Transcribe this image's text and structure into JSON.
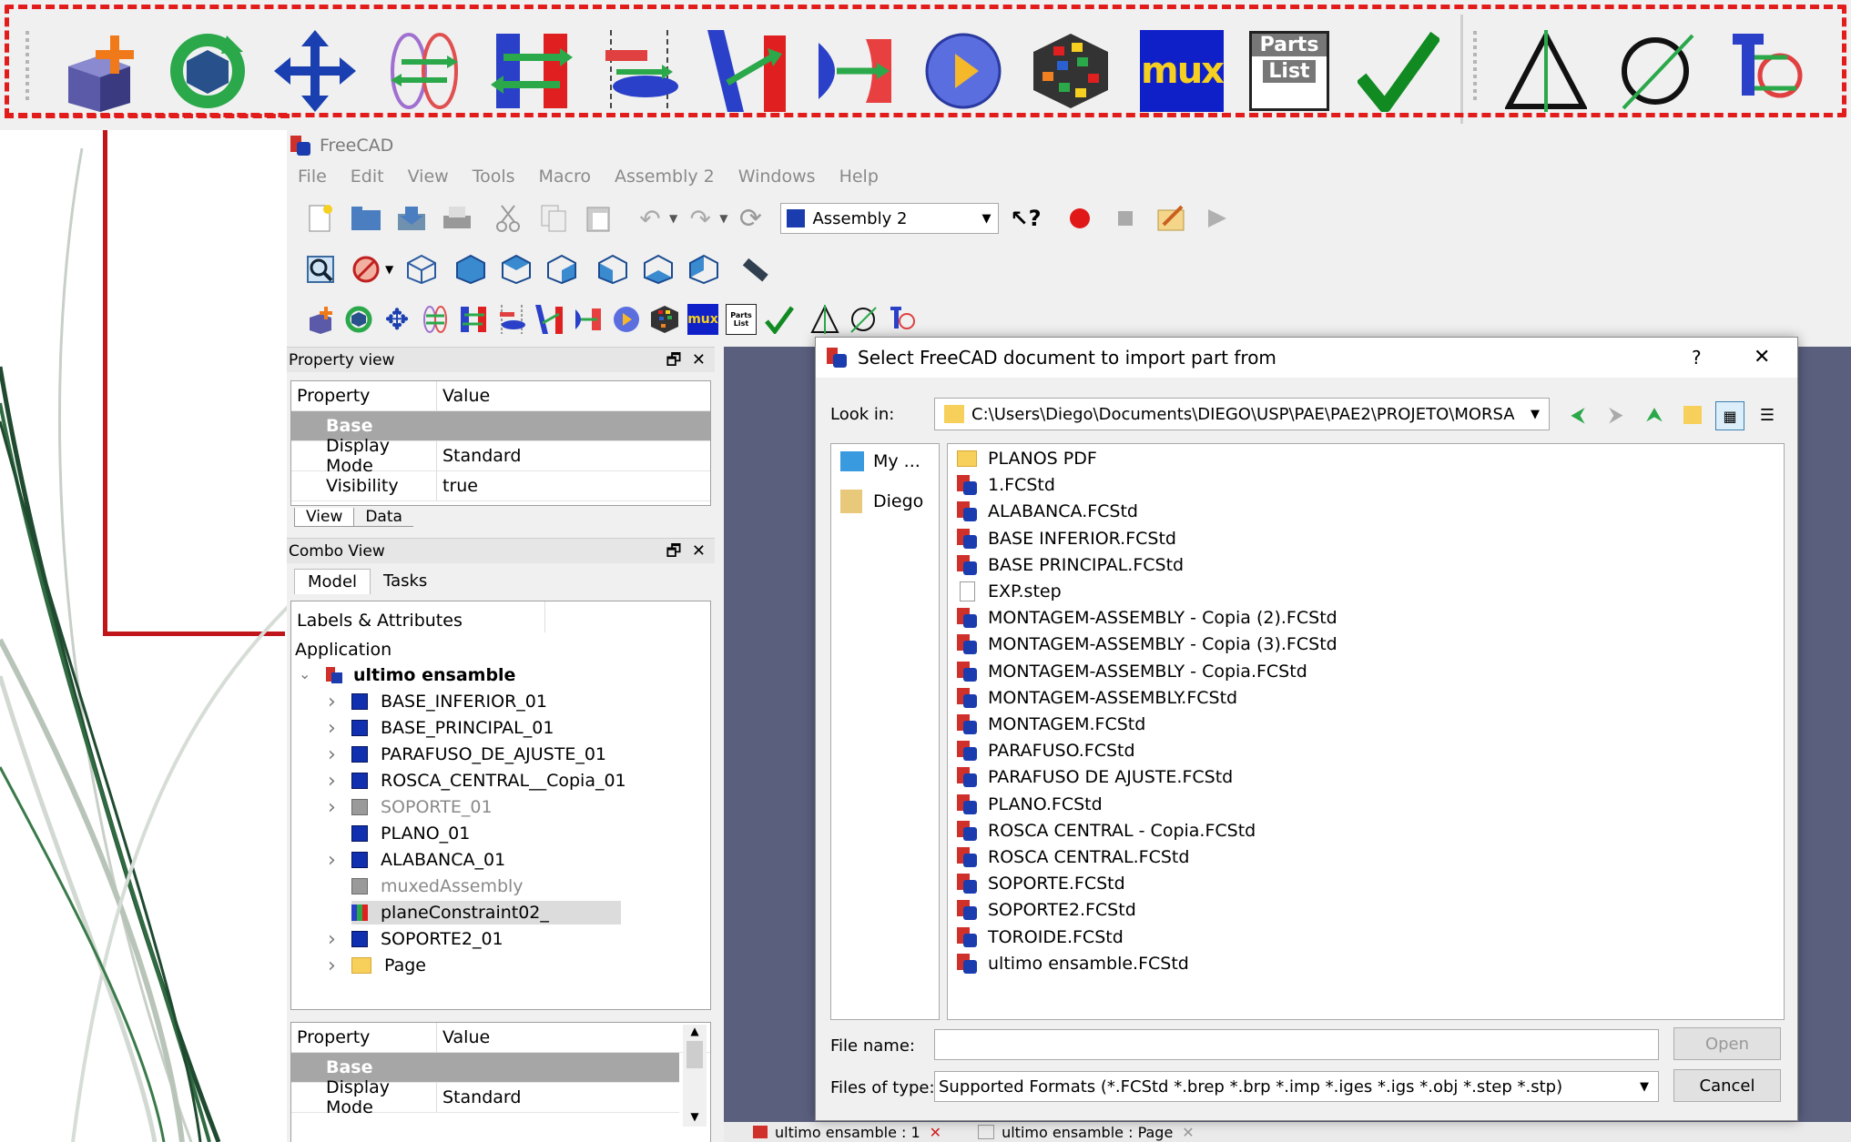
{
  "window_title": "FreeCAD",
  "menu": [
    "File",
    "Edit",
    "View",
    "Tools",
    "Macro",
    "Assembly 2",
    "Windows",
    "Help"
  ],
  "workbench_selector": "Assembly 2",
  "banner_icons": [
    "import-part-icon",
    "update-part-icon",
    "move-part-icon",
    "circular-edge-constraint-icon",
    "plane-constraint-icon",
    "axial-constraint-icon",
    "angle-constraint-icon",
    "spherical-surface-constraint-icon",
    "solve-constraints-icon",
    "animate-icon",
    "mux-assembly-icon",
    "parts-list-icon",
    "check-assembly-icon",
    "triangle-icon",
    "circle-icon",
    "cad-icon"
  ],
  "banner_text": {
    "mux": "mux",
    "parts1": "Parts",
    "parts2": "List"
  },
  "property_view": {
    "title": "Property view",
    "col_property": "Property",
    "col_value": "Value",
    "group": "Base",
    "rows": [
      {
        "name": "Display Mode",
        "value": "Standard"
      },
      {
        "name": "Visibility",
        "value": "true"
      }
    ],
    "tabs": [
      "View",
      "Data"
    ]
  },
  "combo_view": {
    "title": "Combo View",
    "tabs": [
      "Model",
      "Tasks"
    ],
    "labels_header": "Labels & Attributes",
    "application": "Application",
    "root": "ultimo ensamble",
    "items": [
      {
        "label": "BASE_INFERIOR_01",
        "expandable": true,
        "greyed": false
      },
      {
        "label": "BASE_PRINCIPAL_01",
        "expandable": true,
        "greyed": false
      },
      {
        "label": "PARAFUSO_DE_AJUSTE_01",
        "expandable": true,
        "greyed": false
      },
      {
        "label": "ROSCA_CENTRAL__Copia_01",
        "expandable": true,
        "greyed": false
      },
      {
        "label": "SOPORTE_01",
        "expandable": true,
        "greyed": true
      },
      {
        "label": "PLANO_01",
        "expandable": false,
        "greyed": false
      },
      {
        "label": "ALABANCA_01",
        "expandable": true,
        "greyed": false
      },
      {
        "label": "muxedAssembly",
        "expandable": false,
        "greyed": true
      },
      {
        "label": "planeConstraint02_",
        "expandable": false,
        "greyed": false
      },
      {
        "label": "SOPORTE2_01",
        "expandable": true,
        "greyed": false
      },
      {
        "label": "Page",
        "expandable": true,
        "greyed": false
      }
    ]
  },
  "property_view2": {
    "col_property": "Property",
    "col_value": "Value",
    "group": "Base",
    "rows": [
      {
        "name": "Display Mode",
        "value": "Standard"
      }
    ],
    "tabs": [
      "View",
      "Data"
    ]
  },
  "dialog": {
    "title": "Select FreeCAD document to import part from",
    "help": "?",
    "close": "✕",
    "look_in_label": "Look in:",
    "look_in_path": "C:\\Users\\Diego\\Documents\\DIEGO\\USP\\PAE\\PAE2\\PROJETO\\MORSA",
    "places": [
      "My ...",
      "Diego"
    ],
    "files": [
      {
        "name": "PLANOS PDF",
        "type": "folder"
      },
      {
        "name": "1.FCStd",
        "type": "fcstd"
      },
      {
        "name": "ALABANCA.FCStd",
        "type": "fcstd"
      },
      {
        "name": "BASE INFERIOR.FCStd",
        "type": "fcstd"
      },
      {
        "name": "BASE PRINCIPAL.FCStd",
        "type": "fcstd"
      },
      {
        "name": "EXP.step",
        "type": "file"
      },
      {
        "name": "MONTAGEM-ASSEMBLY - Copia (2).FCStd",
        "type": "fcstd"
      },
      {
        "name": "MONTAGEM-ASSEMBLY - Copia (3).FCStd",
        "type": "fcstd"
      },
      {
        "name": "MONTAGEM-ASSEMBLY - Copia.FCStd",
        "type": "fcstd"
      },
      {
        "name": "MONTAGEM-ASSEMBLY.FCStd",
        "type": "fcstd"
      },
      {
        "name": "MONTAGEM.FCStd",
        "type": "fcstd"
      },
      {
        "name": "PARAFUSO.FCStd",
        "type": "fcstd"
      },
      {
        "name": "PARAFUSO DE AJUSTE.FCStd",
        "type": "fcstd"
      },
      {
        "name": "PLANO.FCStd",
        "type": "fcstd"
      },
      {
        "name": "ROSCA CENTRAL - Copia.FCStd",
        "type": "fcstd"
      },
      {
        "name": "ROSCA CENTRAL.FCStd",
        "type": "fcstd"
      },
      {
        "name": "SOPORTE.FCStd",
        "type": "fcstd"
      },
      {
        "name": "SOPORTE2.FCStd",
        "type": "fcstd"
      },
      {
        "name": "TOROIDE.FCStd",
        "type": "fcstd"
      },
      {
        "name": "ultimo ensamble.FCStd",
        "type": "fcstd"
      }
    ],
    "file_name_label": "File name:",
    "file_name_value": "",
    "file_type_label": "Files of type:",
    "file_type_value": "Supported Formats (*.FCStd *.brep *.brp *.imp *.iges *.igs *.obj *.step *.stp)",
    "open_label": "Open",
    "cancel_label": "Cancel"
  },
  "bottom_tabs": [
    "ultimo ensamble : 1",
    "ultimo ensamble : Page"
  ],
  "colors": {
    "highlight_red": "#e21b1b",
    "base_row": "#a6a6a6",
    "viewport": "#5a5f7e"
  }
}
